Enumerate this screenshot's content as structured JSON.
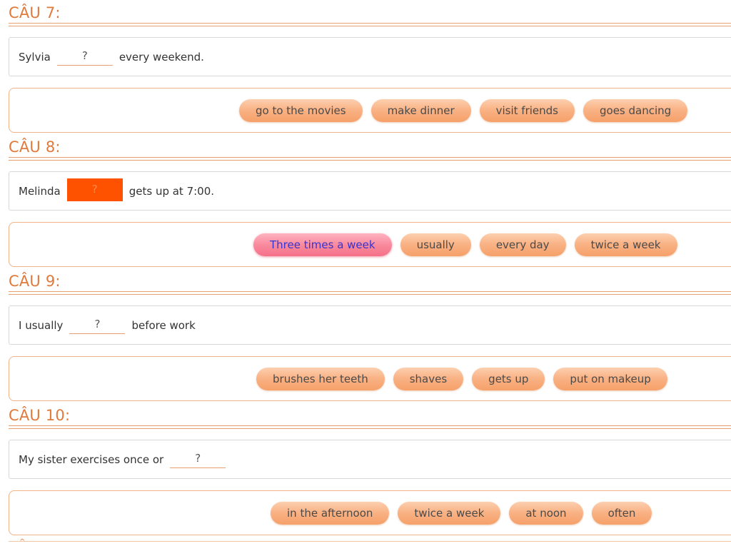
{
  "questions": [
    {
      "title": "CÂU 7:",
      "before": "Sylvia",
      "blank": "?",
      "after": "every weekend.",
      "options": [
        "go to the movies",
        "make dinner",
        "visit friends",
        "goes dancing"
      ]
    },
    {
      "title": "CÂU 8:",
      "before": "Melinda",
      "blank": "?",
      "after": "gets up at 7:00.",
      "options": [
        "Three times a week",
        "usually",
        "every day",
        "twice a week"
      ]
    },
    {
      "title": "CÂU 9:",
      "before": "I usually",
      "blank": "?",
      "after": "before work",
      "options": [
        "brushes her teeth",
        "shaves",
        "gets up",
        "put on makeup"
      ]
    },
    {
      "title": "CÂU 10:",
      "before": "My sister exercises once or",
      "blank": "?",
      "after": "",
      "options": [
        "in the afternoon",
        "twice a week",
        "at noon",
        "often"
      ]
    }
  ],
  "colors": {
    "accent": "#e07a3c",
    "chip_fill": "#f9b386",
    "chip_selected": "#f98a9e",
    "blank_active": "#ff5200"
  },
  "icons": {
    "peek_caret": "^"
  }
}
